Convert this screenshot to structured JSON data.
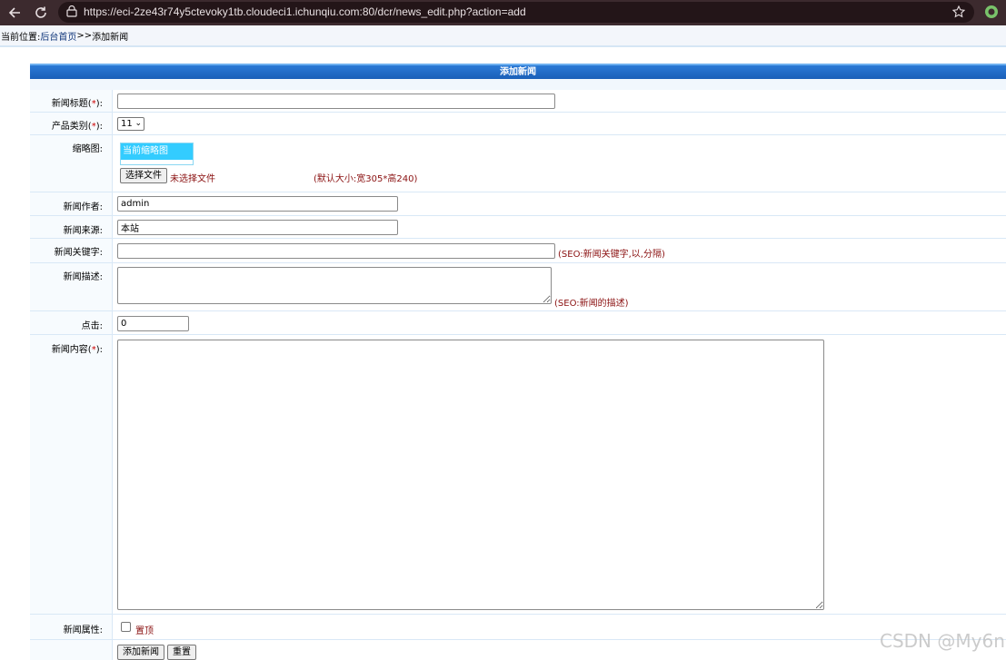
{
  "browser": {
    "url": "https://eci-2ze43r74y5ctevoky1tb.cloudeci1.ichunqiu.com:80/dcr/news_edit.php?action=add",
    "accent_color": "#3c2a2e"
  },
  "breadcrumb": {
    "prefix": "当前位置:",
    "home_link": "后台首页",
    "separator": ">>",
    "current": "添加新闻"
  },
  "form": {
    "title": "添加新闻",
    "fields": {
      "title": {
        "label": "新闻标题(",
        "required": "*",
        "suffix": "):",
        "value": ""
      },
      "category": {
        "label": "产品类别(",
        "required": "*",
        "suffix": "):",
        "selected": "11"
      },
      "thumbnail": {
        "label": "缩略图:",
        "current_label": "当前缩略图",
        "choose_button": "选择文件",
        "no_file_text": "未选择文件",
        "size_hint": "(默认大小:宽305*高240)"
      },
      "author": {
        "label": "新闻作者:",
        "value": "admin"
      },
      "source": {
        "label": "新闻来源:",
        "value": "本站"
      },
      "keywords": {
        "label": "新闻关键字:",
        "value": "",
        "hint": "(SEO:新闻关键字,以,分隔)"
      },
      "description": {
        "label": "新闻描述:",
        "value": "",
        "hint": "(SEO:新闻的描述)"
      },
      "clicks": {
        "label": "点击:",
        "value": "0"
      },
      "content": {
        "label": "新闻内容(",
        "required": "*",
        "suffix": "):",
        "value": ""
      },
      "attributes": {
        "label": "新闻属性:",
        "checkbox_label": "置顶",
        "checked": false
      }
    },
    "buttons": {
      "submit": "添加新闻",
      "reset": "重置"
    }
  },
  "watermark": "CSDN @My6n"
}
